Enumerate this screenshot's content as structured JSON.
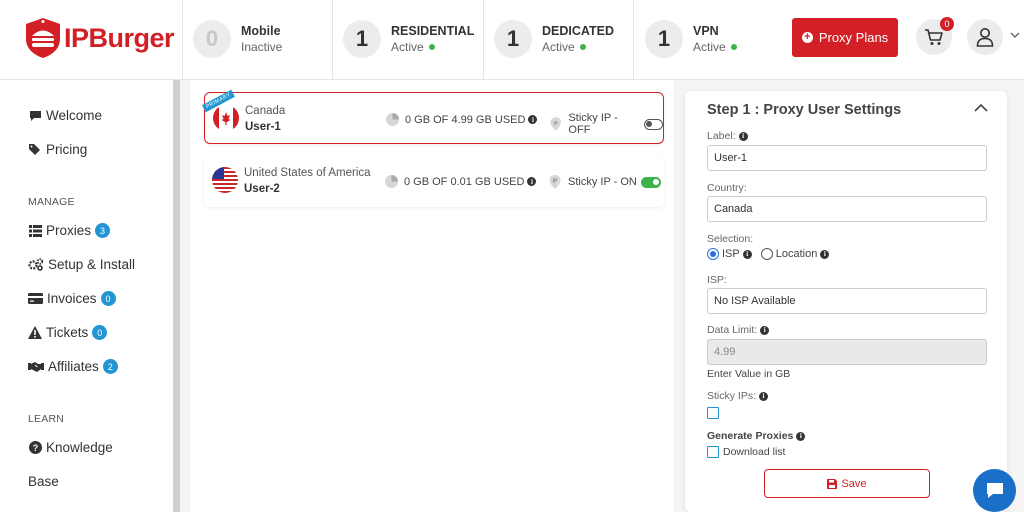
{
  "brand": {
    "name": "IPBurger",
    "accent": "#d32027"
  },
  "header": {
    "stats": [
      {
        "count": "0",
        "title": "Mobile",
        "status": "Inactive",
        "active": false
      },
      {
        "count": "1",
        "title": "RESIDENTIAL",
        "status": "Active",
        "active": true
      },
      {
        "count": "1",
        "title": "DEDICATED",
        "status": "Active",
        "active": true
      },
      {
        "count": "1",
        "title": "VPN",
        "status": "Active",
        "active": true
      }
    ],
    "proxy_plans_label": "Proxy Plans",
    "cart_count": "0"
  },
  "sidebar": {
    "items": [
      {
        "label": "Welcome",
        "icon": "comment-icon"
      },
      {
        "label": "Pricing",
        "icon": "tags-icon"
      }
    ],
    "manage_title": "MANAGE",
    "manage": [
      {
        "label": "Proxies",
        "badge": "3",
        "icon": "list-icon"
      },
      {
        "label": "Setup & Install",
        "icon": "cogs-icon"
      },
      {
        "label": "Invoices",
        "badge": "0",
        "icon": "credit-card-icon"
      },
      {
        "label": "Tickets",
        "badge": "0",
        "icon": "warning-icon"
      },
      {
        "label": "Affiliates",
        "badge": "2",
        "icon": "handshake-icon"
      }
    ],
    "learn_title": "LEARN",
    "learn": [
      {
        "label": "Knowledge",
        "icon": "question-circle-icon"
      },
      {
        "label": "Base"
      }
    ]
  },
  "proxies": [
    {
      "country": "Canada",
      "user": "User-1",
      "usage": "0 GB OF 4.99 GB USED",
      "sticky": "Sticky IP - OFF",
      "sticky_on": false,
      "ribbon": "PRIMARY",
      "selected": true
    },
    {
      "country": "United States of America",
      "user": "User-2",
      "usage": "0 GB OF 0.01 GB USED",
      "sticky": "Sticky IP - ON",
      "sticky_on": true,
      "selected": false
    }
  ],
  "settings": {
    "title": "Step 1 : Proxy User Settings",
    "label_label": "Label:",
    "label_value": "User-1",
    "country_label": "Country:",
    "country_value": "Canada",
    "selection_label": "Selection:",
    "selection_options": [
      "ISP",
      "Location"
    ],
    "selection_selected": "ISP",
    "isp_label": "ISP:",
    "isp_value": "No ISP Available",
    "data_limit_label": "Data Limit:",
    "data_limit_value": "4.99",
    "data_limit_hint": "Enter Value in GB",
    "sticky_label": "Sticky IPs:",
    "generate_label": "Generate Proxies",
    "download_label": "Download list",
    "save_label": "Save"
  }
}
